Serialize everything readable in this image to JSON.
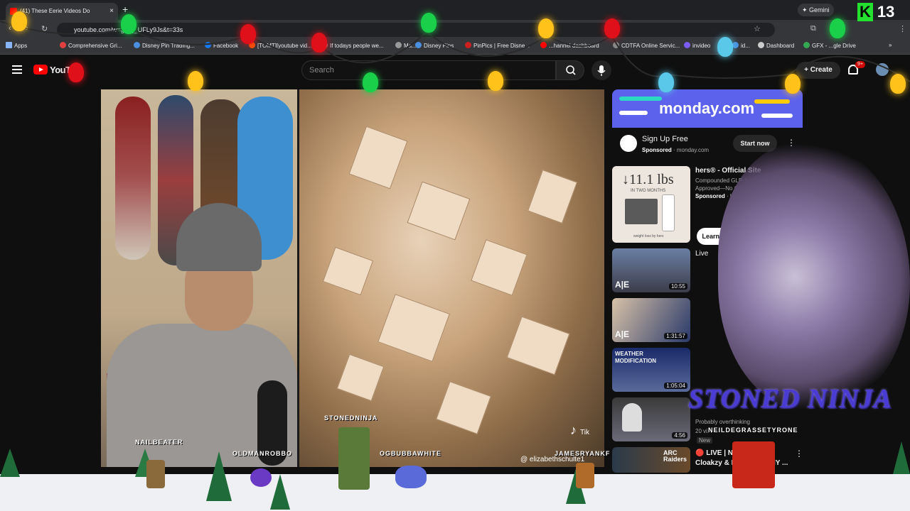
{
  "browser": {
    "tab_title": "(41) These Eerie Videos Do",
    "tab_close": "×",
    "new_tab": "+",
    "gemini_label": "Gemini",
    "url": "youtube.com/w",
    "url_suffix": "=gGQ_UFLy9Js&t=33s",
    "bookmarks": [
      "Apps",
      "Comprehensive Gri...",
      "Disney Pin Trading...",
      "Facebook",
      "[TOMT][youtube vid...",
      "If todays people we...",
      "Ma...",
      "Disney Pins",
      "PinPics | Free Disne...",
      "...hannel dashboard",
      "CDTFA Online Servic...",
      "invideo",
      "id...",
      "Dashboard",
      "GFX - ...gle Drive"
    ]
  },
  "youtube": {
    "logo_text": "YouT",
    "search_placeholder": "Search",
    "create_label": "Create",
    "notifications_badge": "9+"
  },
  "player": {
    "tiktok_label": "Tik",
    "tiktok_handle": "@ elizabethschulte1"
  },
  "sidebar": {
    "ad1": {
      "logo": "monday.com",
      "title": "Sign Up Free",
      "sponsored": "Sponsored",
      "domain": "monday.com",
      "cta": "Start now"
    },
    "ad2": {
      "weight": "↓11.1 lbs",
      "period": "IN TWO MONTHS",
      "footer": "weight loss by hers",
      "title": "hers® - Official Site",
      "line1": "Compounded GLP-1s",
      "line2": "Approved—No Clinic Vi...",
      "sponsored": "Sponsored",
      "advertiser": "hers",
      "cta": "Learn more"
    },
    "videos": [
      {
        "title": "Live",
        "duration": "10:55",
        "channel_badge": "A|E"
      },
      {
        "title": "",
        "duration": "1:31:57",
        "channel_badge": "A|E"
      },
      {
        "title": "WEATHER MODIFICATION",
        "duration": "1:05:04",
        "channel_badge": ""
      },
      {
        "title": "Probably overthinking",
        "subtitle": "20 vi...",
        "tag": "New",
        "duration": "4:56",
        "channel_badge": ""
      },
      {
        "title": "🔴 LIVE | NUT...",
        "subtitle": "Cloakzy & Hutch... MANY ...",
        "duration": "",
        "channel_badge": "ARC Raiders"
      }
    ]
  },
  "overlay": {
    "stream_title": "STONED NINJA",
    "counter_k": "K",
    "counter_value": "13",
    "chat_names": [
      "NAILBEATER",
      "OLDMANROBBO",
      "STONEDNINJA",
      "OGBUBBAWHITE",
      "JAMESRYANKF",
      "NEILDEGRASSETYRONE"
    ]
  },
  "colors": {
    "youtube_red": "#ff0000",
    "monday_purple": "#5c62ec",
    "stoned_ninja_text": "#4a3bd4",
    "counter_green": "#24e02f"
  }
}
